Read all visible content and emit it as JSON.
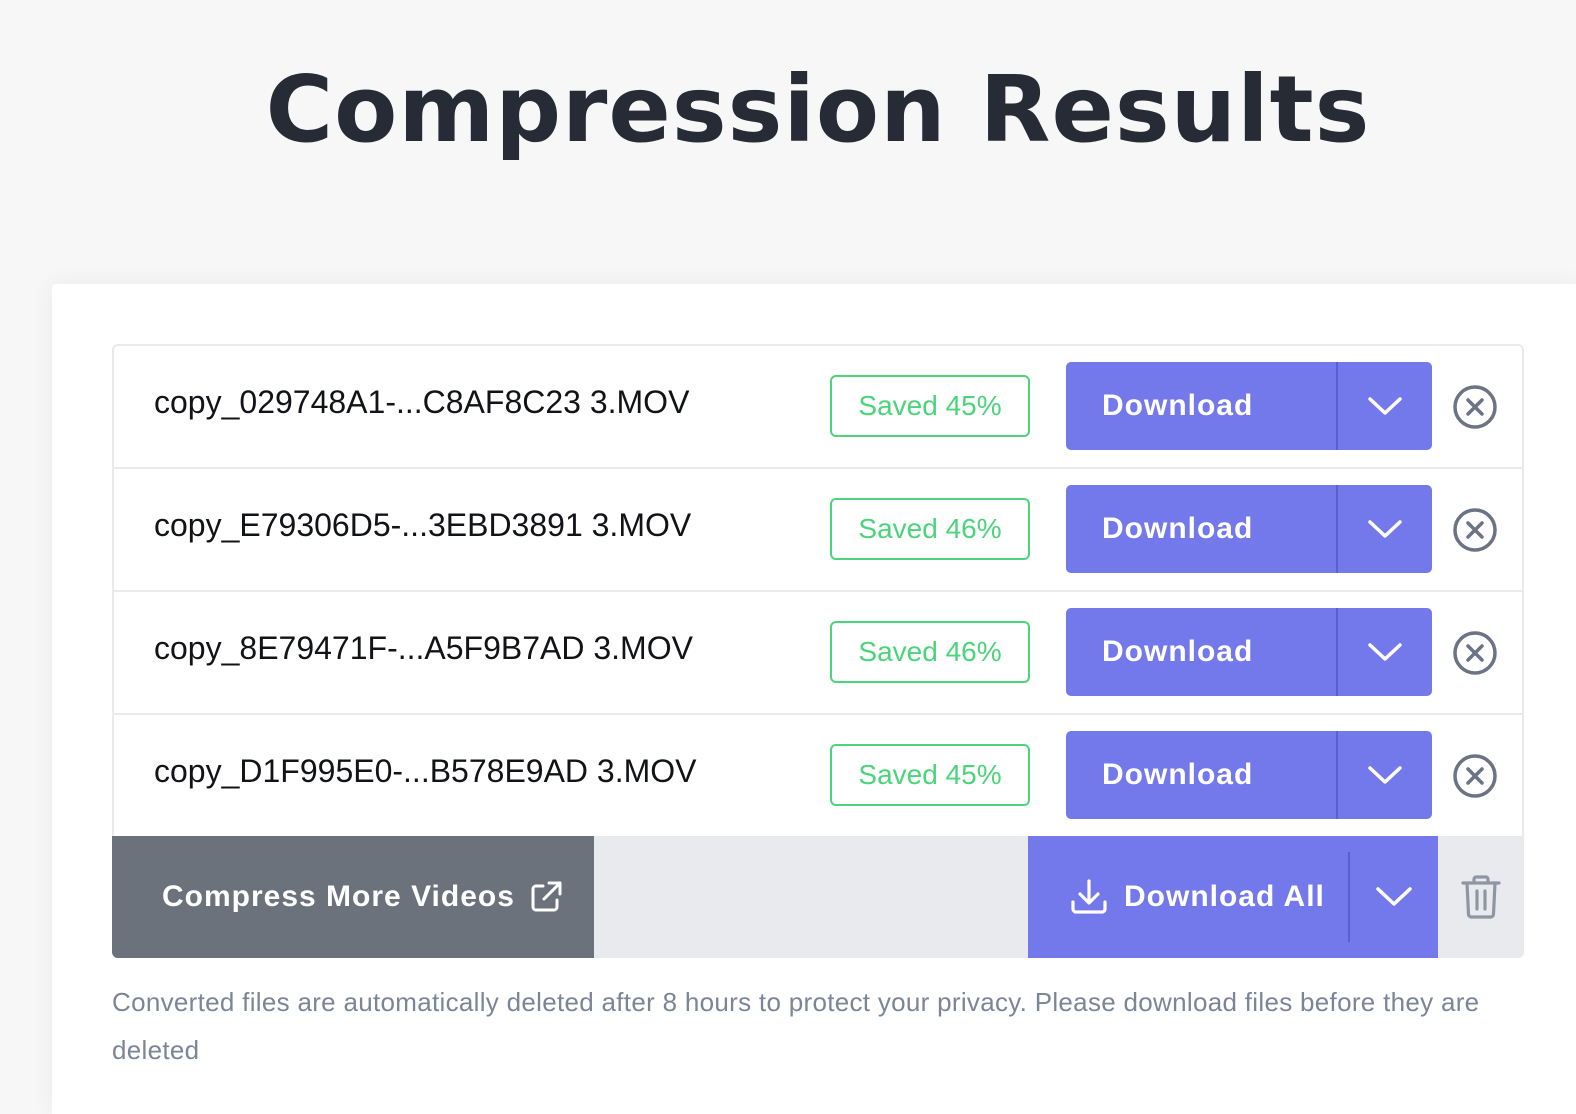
{
  "page": {
    "title": "Compression Results"
  },
  "files": [
    {
      "name": "copy_029748A1-...C8AF8C23 3.MOV",
      "saved": "Saved 45%",
      "download_label": "Download"
    },
    {
      "name": "copy_E79306D5-...3EBD3891 3.MOV",
      "saved": "Saved 46%",
      "download_label": "Download"
    },
    {
      "name": "copy_8E79471F-...A5F9B7AD 3.MOV",
      "saved": "Saved 46%",
      "download_label": "Download"
    },
    {
      "name": "copy_D1F995E0-...B578E9AD 3.MOV",
      "saved": "Saved 45%",
      "download_label": "Download"
    }
  ],
  "actions": {
    "compress_more_label": "Compress More Videos",
    "download_all_label": "Download All"
  },
  "privacy_note": "Converted files are automatically deleted after 8 hours to protect your privacy. Please download files before they are deleted",
  "colors": {
    "accent": "#7379ea",
    "saved_green": "#4cd47b",
    "secondary_button": "#6b727c",
    "title_text": "#262b35",
    "note_text": "#7c8597"
  },
  "icons": {
    "row_caret": "chevron-down-icon",
    "row_remove": "close-circle-icon",
    "compress_more": "external-link-icon",
    "download_all": "download-icon",
    "clear_all": "trash-icon"
  }
}
